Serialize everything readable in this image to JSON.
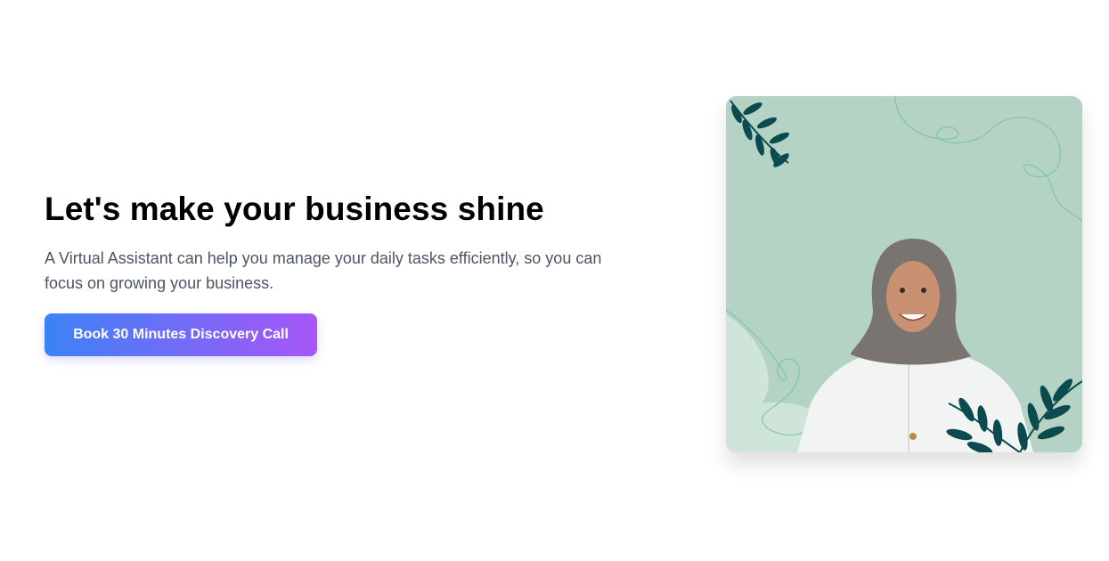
{
  "hero": {
    "headline": "Let's make your business shine",
    "subtitle": "A Virtual Assistant can help you manage your daily tasks efficiently, so you can focus on growing your business.",
    "cta_label": "Book 30 Minutes Discovery Call"
  },
  "photo": {
    "background_color": "#b4d3c4",
    "leaf_color": "#0b4a4f",
    "accent_gradient": [
      "#3b82f6",
      "#a855f7"
    ]
  }
}
